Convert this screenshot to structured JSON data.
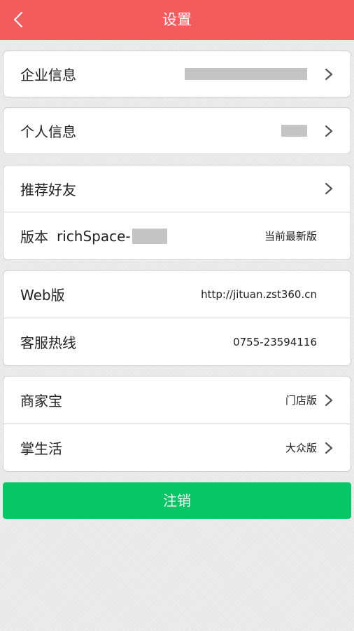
{
  "header": {
    "title": "设置",
    "back_icon": "chevron-left-icon",
    "color": "#f35b5d"
  },
  "groups": {
    "company": {
      "label": "企业信息"
    },
    "personal": {
      "label": "个人信息"
    },
    "recommend": {
      "label": "推荐好友"
    },
    "version": {
      "label": "版本",
      "app_name": "richSpace-",
      "status": "当前最新版"
    },
    "web": {
      "label": "Web版",
      "value": "http://jituan.zst360.cn"
    },
    "hotline": {
      "label": "客服热线",
      "value": "0755-23594116"
    },
    "merchant": {
      "label": "商家宝",
      "value": "门店版"
    },
    "life": {
      "label": "掌生活",
      "value": "大众版"
    }
  },
  "logout": {
    "label": "注销",
    "color": "#06c665"
  },
  "icons": {
    "row_arrow": "chevron-right-icon"
  }
}
